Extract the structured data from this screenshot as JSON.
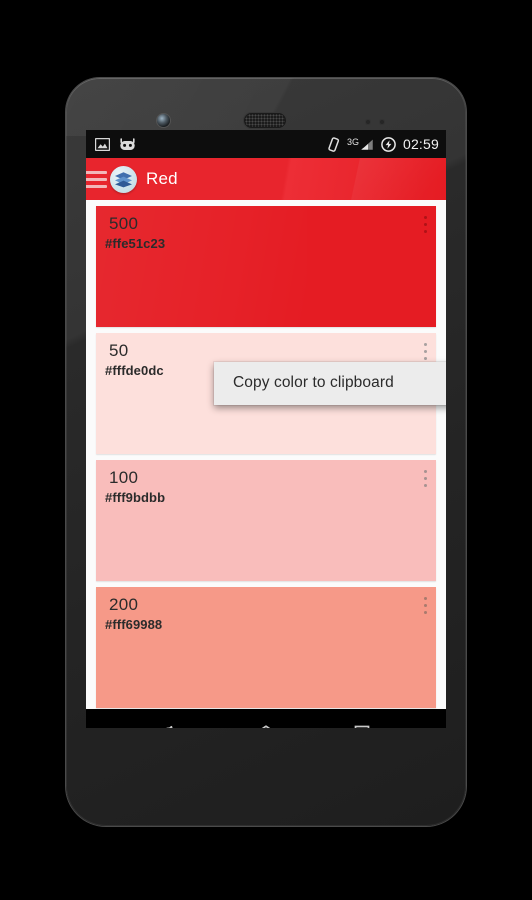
{
  "device": {
    "hardware": {
      "front_camera": "front-camera",
      "earpiece": "earpiece-speaker",
      "sensors": [
        "proximity-sensor",
        "light-sensor"
      ]
    }
  },
  "status_bar": {
    "left_icons": [
      {
        "name": "screenshot-notification-icon",
        "label": "screenshot"
      },
      {
        "name": "cyanogenmod-icon",
        "label": "cid"
      }
    ],
    "right_icons": [
      {
        "name": "vibrate-icon",
        "label": "vibrate"
      },
      {
        "name": "signal-3g-icon",
        "label": "3G"
      },
      {
        "name": "charging-icon",
        "label": "charging"
      }
    ],
    "network_label": "3G",
    "time": "02:59"
  },
  "app_bar": {
    "menu_icon": "hamburger-menu-icon",
    "app_icon": "layers-app-icon",
    "title": "Red",
    "background_color": "#e51c23"
  },
  "colors_list": [
    {
      "name": "500",
      "hex": "#ffe51c23",
      "swatch": "#e51c23",
      "text_color": "#2b2b2b",
      "dot_color": "#b01217"
    },
    {
      "name": "50",
      "hex": "#fffde0dc",
      "swatch": "#fde0dc",
      "text_color": "#2b2b2b",
      "dot_color": "#a8a0a0"
    },
    {
      "name": "100",
      "hex": "#fff9bdbb",
      "swatch": "#f9bdbb",
      "text_color": "#2b2b2b",
      "dot_color": "#a79291"
    },
    {
      "name": "200",
      "hex": "#fff69988",
      "swatch": "#f69988",
      "text_color": "#2b2b2b",
      "dot_color": "#a97a6d"
    }
  ],
  "context_menu": {
    "visible": true,
    "items": [
      {
        "label": "Copy color to clipboard"
      }
    ],
    "background_color": "#ececec"
  },
  "nav_bar": {
    "buttons": [
      {
        "name": "back-button",
        "label": "Back"
      },
      {
        "name": "home-button",
        "label": "Home"
      },
      {
        "name": "recents-button",
        "label": "Recents"
      }
    ]
  }
}
